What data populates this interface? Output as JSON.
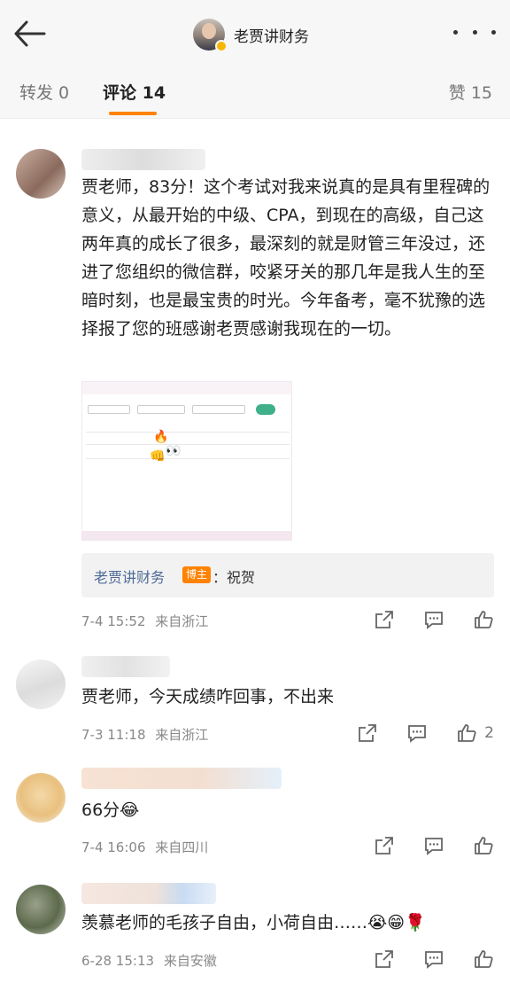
{
  "header": {
    "title": "老贾讲财务",
    "icons": [
      "back-arrow-icon",
      "more-icon"
    ]
  },
  "tabs": {
    "repost": "转发 0",
    "comment": "评论 14",
    "like": "赞 15"
  },
  "comments": [
    {
      "text": "贾老师，83分！这个考试对我来说真的是具有里程碑的意义，从最开始的中级、CPA，到现在的高级，自己这两年真的成长了很多，最深刻的就是财管三年没过，还进了您组织的微信群，咬紧牙关的那几年是我人生的至暗时刻，也是最宝贵的时光。今年备考，毫不犹豫的选择报了您的班感谢老贾感谢我现在的一切。",
      "reply": {
        "author": "老贾讲财务",
        "badge": "博主",
        "text": "：祝贺"
      },
      "time": "7-4 15:52",
      "location": "来自浙江",
      "likes": ""
    },
    {
      "text": "贾老师，今天成绩咋回事，不出来",
      "time": "7-3 11:18",
      "location": "来自浙江",
      "likes": "2"
    },
    {
      "text": "66分😂",
      "time": "7-4 16:06",
      "location": "来自四川",
      "likes": ""
    },
    {
      "text": "羡慕老师的毛孩子自由，小荷自由……😭😁🌹",
      "time": "6-28 15:13",
      "location": "来自安徽",
      "likes": ""
    }
  ],
  "colors": {
    "accent": "#ff8200",
    "link": "#4e6b98",
    "badge": "#ff8200"
  }
}
